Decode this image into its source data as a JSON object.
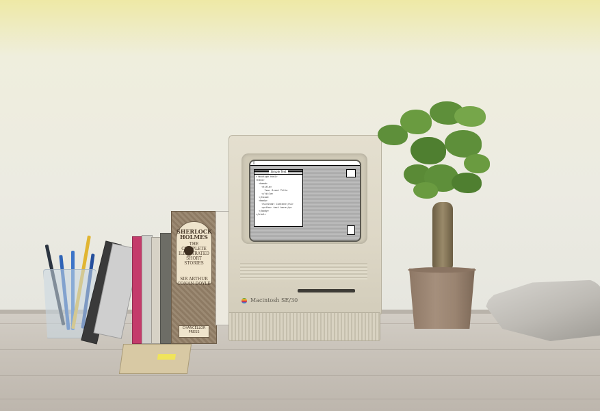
{
  "scene": {
    "computer_label": "Macintosh SE/30",
    "book_title": "SHERLOCK HOLMES",
    "book_subtitle": "THE COMPLETE ILLUSTRATED SHORT STORIES",
    "book_author": "SIR ARTHUR CONAN DOYLE",
    "book_publisher": "CHANCELLOR PRESS"
  },
  "screen": {
    "window_title": "Simple Text",
    "code_text": "<!doctype html>\n<html>\n  <head>\n    <title>\n      Your Great Title\n    </title>\n  </head>\n  <body>\n    <h1>Great Content</h1>\n    <p>Your text here</p>\n  </body>\n</html>"
  }
}
